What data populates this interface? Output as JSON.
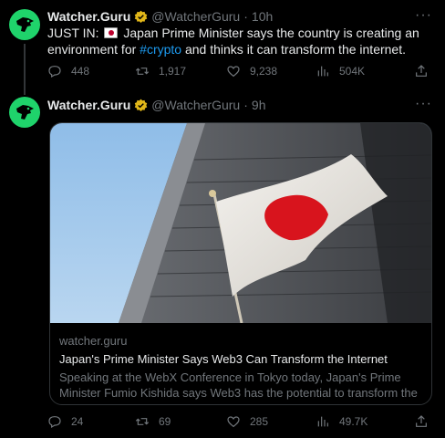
{
  "tweets": [
    {
      "name": "Watcher.Guru",
      "handle": "@WatcherGuru",
      "dot": "·",
      "time": "10h",
      "text_lead": "JUST IN:",
      "text_mid": "Japan Prime Minister says the country is creating an environment for",
      "hashtag": "#crypto",
      "text_tail": "and thinks it can transform the internet.",
      "stats": {
        "replies": "448",
        "retweets": "1,917",
        "likes": "9,238",
        "views": "504K"
      }
    },
    {
      "name": "Watcher.Guru",
      "handle": "@WatcherGuru",
      "dot": "·",
      "time": "9h",
      "card": {
        "domain": "watcher.guru",
        "title": "Japan's Prime Minister Says Web3 Can Transform the Internet",
        "description": "Speaking at the WebX Conference in Tokyo today, Japan's Prime Minister Fumio Kishida says Web3 has the potential to transform the ..."
      },
      "stats": {
        "replies": "24",
        "retweets": "69",
        "likes": "285",
        "views": "49.7K"
      }
    }
  ],
  "more_glyph": "···",
  "icons": {
    "avatar": "watcher-guru-dog-logo",
    "badge": "gold-verified-badge",
    "flag": "japan-flag-emoji",
    "reply": "reply-icon",
    "retweet": "retweet-icon",
    "like": "heart-icon",
    "views": "views-icon",
    "share": "share-icon"
  },
  "colors": {
    "avatar_bg": "#1fd36b",
    "badge": "#e2b719",
    "link": "#1d9bf0",
    "muted": "#71767b"
  }
}
